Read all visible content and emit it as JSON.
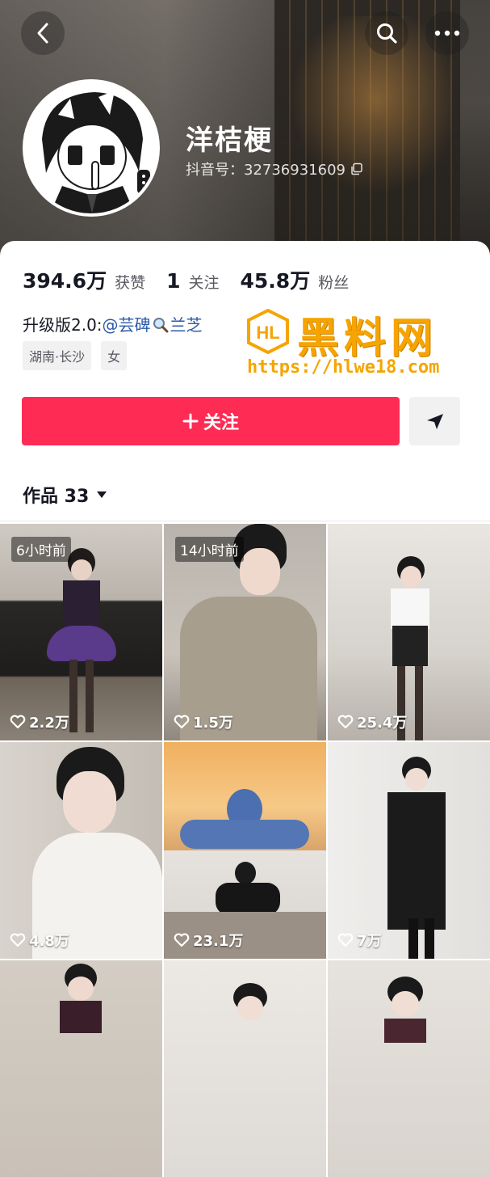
{
  "header": {
    "username": "洋桔梗",
    "douyin_id": "抖音号：32736931609"
  },
  "stats": [
    {
      "num": "394.6万",
      "label": "获赞"
    },
    {
      "num": "1",
      "label": "关注"
    },
    {
      "num": "45.8万",
      "label": "粉丝"
    }
  ],
  "bio": {
    "prefix": "升级版2.0:",
    "mention": "@芸碑",
    "suffix": "兰芝"
  },
  "tags": [
    "湖南·长沙",
    "女"
  ],
  "watermark": {
    "title": "黑料网",
    "logo_text": "HL",
    "url": "https://hlwe18.com"
  },
  "buttons": {
    "follow": "关注"
  },
  "works": {
    "label": "作品 33"
  },
  "videos": [
    {
      "timestamp": "6小时前",
      "likes": "2.2万"
    },
    {
      "timestamp": "14小时前",
      "likes": "1.5万"
    },
    {
      "timestamp": "",
      "likes": "25.4万"
    },
    {
      "timestamp": "",
      "likes": "4.8万"
    },
    {
      "timestamp": "",
      "likes": "23.1万"
    },
    {
      "timestamp": "",
      "likes": "7万"
    },
    {
      "timestamp": "",
      "likes": ""
    },
    {
      "timestamp": "",
      "likes": ""
    },
    {
      "timestamp": "",
      "likes": ""
    }
  ],
  "colors": {
    "accent": "#fe2c55",
    "mention": "#2b5aa8",
    "watermark": "#f6a400"
  }
}
